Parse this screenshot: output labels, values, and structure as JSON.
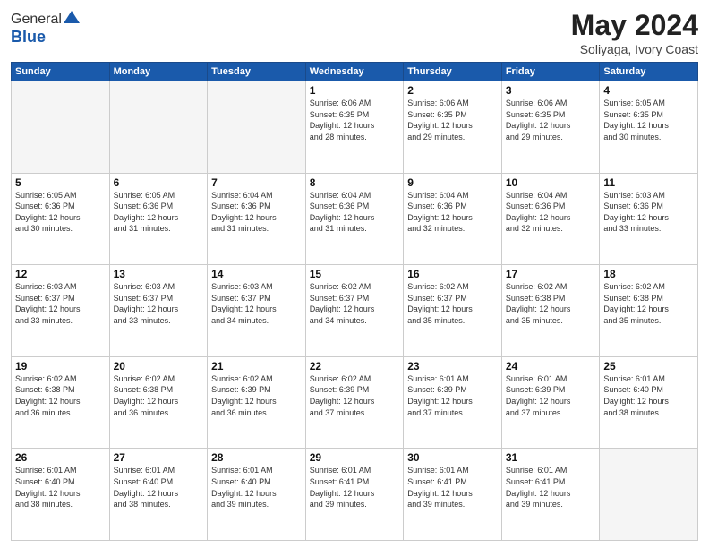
{
  "header": {
    "logo_general": "General",
    "logo_blue": "Blue",
    "title": "May 2024",
    "location": "Soliyaga, Ivory Coast"
  },
  "weekdays": [
    "Sunday",
    "Monday",
    "Tuesday",
    "Wednesday",
    "Thursday",
    "Friday",
    "Saturday"
  ],
  "weeks": [
    [
      {
        "day": "",
        "info": ""
      },
      {
        "day": "",
        "info": ""
      },
      {
        "day": "",
        "info": ""
      },
      {
        "day": "1",
        "info": "Sunrise: 6:06 AM\nSunset: 6:35 PM\nDaylight: 12 hours\nand 28 minutes."
      },
      {
        "day": "2",
        "info": "Sunrise: 6:06 AM\nSunset: 6:35 PM\nDaylight: 12 hours\nand 29 minutes."
      },
      {
        "day": "3",
        "info": "Sunrise: 6:06 AM\nSunset: 6:35 PM\nDaylight: 12 hours\nand 29 minutes."
      },
      {
        "day": "4",
        "info": "Sunrise: 6:05 AM\nSunset: 6:35 PM\nDaylight: 12 hours\nand 30 minutes."
      }
    ],
    [
      {
        "day": "5",
        "info": "Sunrise: 6:05 AM\nSunset: 6:36 PM\nDaylight: 12 hours\nand 30 minutes."
      },
      {
        "day": "6",
        "info": "Sunrise: 6:05 AM\nSunset: 6:36 PM\nDaylight: 12 hours\nand 31 minutes."
      },
      {
        "day": "7",
        "info": "Sunrise: 6:04 AM\nSunset: 6:36 PM\nDaylight: 12 hours\nand 31 minutes."
      },
      {
        "day": "8",
        "info": "Sunrise: 6:04 AM\nSunset: 6:36 PM\nDaylight: 12 hours\nand 31 minutes."
      },
      {
        "day": "9",
        "info": "Sunrise: 6:04 AM\nSunset: 6:36 PM\nDaylight: 12 hours\nand 32 minutes."
      },
      {
        "day": "10",
        "info": "Sunrise: 6:04 AM\nSunset: 6:36 PM\nDaylight: 12 hours\nand 32 minutes."
      },
      {
        "day": "11",
        "info": "Sunrise: 6:03 AM\nSunset: 6:36 PM\nDaylight: 12 hours\nand 33 minutes."
      }
    ],
    [
      {
        "day": "12",
        "info": "Sunrise: 6:03 AM\nSunset: 6:37 PM\nDaylight: 12 hours\nand 33 minutes."
      },
      {
        "day": "13",
        "info": "Sunrise: 6:03 AM\nSunset: 6:37 PM\nDaylight: 12 hours\nand 33 minutes."
      },
      {
        "day": "14",
        "info": "Sunrise: 6:03 AM\nSunset: 6:37 PM\nDaylight: 12 hours\nand 34 minutes."
      },
      {
        "day": "15",
        "info": "Sunrise: 6:02 AM\nSunset: 6:37 PM\nDaylight: 12 hours\nand 34 minutes."
      },
      {
        "day": "16",
        "info": "Sunrise: 6:02 AM\nSunset: 6:37 PM\nDaylight: 12 hours\nand 35 minutes."
      },
      {
        "day": "17",
        "info": "Sunrise: 6:02 AM\nSunset: 6:38 PM\nDaylight: 12 hours\nand 35 minutes."
      },
      {
        "day": "18",
        "info": "Sunrise: 6:02 AM\nSunset: 6:38 PM\nDaylight: 12 hours\nand 35 minutes."
      }
    ],
    [
      {
        "day": "19",
        "info": "Sunrise: 6:02 AM\nSunset: 6:38 PM\nDaylight: 12 hours\nand 36 minutes."
      },
      {
        "day": "20",
        "info": "Sunrise: 6:02 AM\nSunset: 6:38 PM\nDaylight: 12 hours\nand 36 minutes."
      },
      {
        "day": "21",
        "info": "Sunrise: 6:02 AM\nSunset: 6:39 PM\nDaylight: 12 hours\nand 36 minutes."
      },
      {
        "day": "22",
        "info": "Sunrise: 6:02 AM\nSunset: 6:39 PM\nDaylight: 12 hours\nand 37 minutes."
      },
      {
        "day": "23",
        "info": "Sunrise: 6:01 AM\nSunset: 6:39 PM\nDaylight: 12 hours\nand 37 minutes."
      },
      {
        "day": "24",
        "info": "Sunrise: 6:01 AM\nSunset: 6:39 PM\nDaylight: 12 hours\nand 37 minutes."
      },
      {
        "day": "25",
        "info": "Sunrise: 6:01 AM\nSunset: 6:40 PM\nDaylight: 12 hours\nand 38 minutes."
      }
    ],
    [
      {
        "day": "26",
        "info": "Sunrise: 6:01 AM\nSunset: 6:40 PM\nDaylight: 12 hours\nand 38 minutes."
      },
      {
        "day": "27",
        "info": "Sunrise: 6:01 AM\nSunset: 6:40 PM\nDaylight: 12 hours\nand 38 minutes."
      },
      {
        "day": "28",
        "info": "Sunrise: 6:01 AM\nSunset: 6:40 PM\nDaylight: 12 hours\nand 39 minutes."
      },
      {
        "day": "29",
        "info": "Sunrise: 6:01 AM\nSunset: 6:41 PM\nDaylight: 12 hours\nand 39 minutes."
      },
      {
        "day": "30",
        "info": "Sunrise: 6:01 AM\nSunset: 6:41 PM\nDaylight: 12 hours\nand 39 minutes."
      },
      {
        "day": "31",
        "info": "Sunrise: 6:01 AM\nSunset: 6:41 PM\nDaylight: 12 hours\nand 39 minutes."
      },
      {
        "day": "",
        "info": ""
      }
    ]
  ]
}
